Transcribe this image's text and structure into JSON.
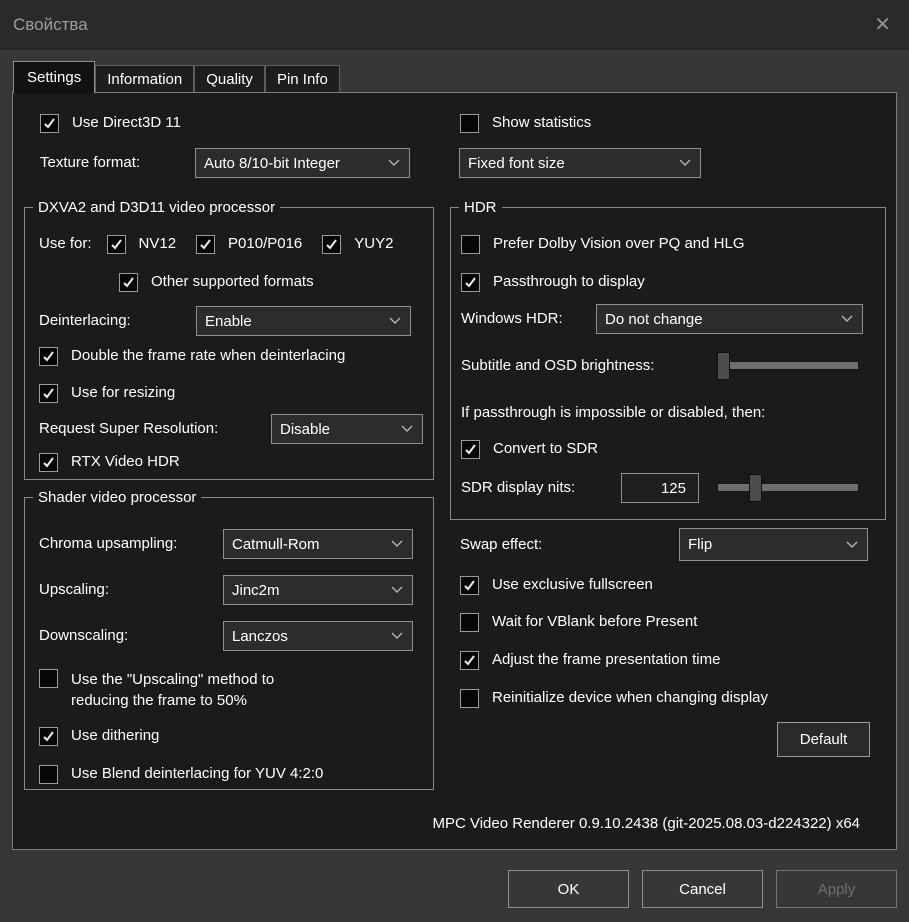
{
  "window": {
    "title": "Свойства"
  },
  "icons": {
    "close": "✕"
  },
  "tabs": {
    "settings": "Settings",
    "information": "Information",
    "quality": "Quality",
    "pin_info": "Pin Info"
  },
  "left": {
    "use_d3d11_label": "Use Direct3D 11",
    "use_d3d11_checked": true,
    "texture_format_label": "Texture format:",
    "texture_format_value": "Auto 8/10-bit Integer",
    "dxva": {
      "title": "DXVA2 and D3D11 video processor",
      "use_for_label": "Use for:",
      "nv12_label": "NV12",
      "nv12_checked": true,
      "p010_label": "P010/P016",
      "p010_checked": true,
      "yuy2_label": "YUY2",
      "yuy2_checked": true,
      "other_label": "Other supported formats",
      "other_checked": true,
      "deinterlacing_label": "Deinterlacing:",
      "deinterlacing_value": "Enable",
      "double_label": "Double the frame rate when deinterlacing",
      "double_checked": true,
      "resizing_label": "Use for resizing",
      "resizing_checked": true,
      "superres_label": "Request Super Resolution:",
      "superres_value": "Disable",
      "rtx_label": "RTX Video HDR",
      "rtx_checked": true
    },
    "shader": {
      "title": "Shader video processor",
      "chroma_label": "Chroma upsampling:",
      "chroma_value": "Catmull-Rom",
      "upscaling_label": "Upscaling:",
      "upscaling_value": "Jinc2m",
      "downscaling_label": "Downscaling:",
      "downscaling_value": "Lanczos",
      "halfres_label": "Use the \"Upscaling\" method to reducing the frame to 50%",
      "halfres_checked": false,
      "dithering_label": "Use dithering",
      "dithering_checked": true,
      "blend_label": "Use Blend deinterlacing for YUV 4:2:0",
      "blend_checked": false
    }
  },
  "right": {
    "show_stats_label": "Show statistics",
    "show_stats_checked": false,
    "font_size_value": "Fixed font size",
    "hdr": {
      "title": "HDR",
      "dolby_label": "Prefer Dolby Vision over PQ and HLG",
      "dolby_checked": false,
      "passthrough_label": "Passthrough to display",
      "passthrough_checked": true,
      "windows_hdr_label": "Windows HDR:",
      "windows_hdr_value": "Do not change",
      "osd_brightness_label": "Subtitle and OSD brightness:",
      "osd_brightness_percent": 0,
      "fallback_text": "If passthrough is impossible or disabled, then:",
      "convert_sdr_label": "Convert to SDR",
      "convert_sdr_checked": true,
      "sdr_nits_label": "SDR display nits:",
      "sdr_nits_value": "125",
      "sdr_nits_percent": 25
    },
    "swap_label": "Swap effect:",
    "swap_value": "Flip",
    "fullscreen_label": "Use exclusive fullscreen",
    "fullscreen_checked": true,
    "vblank_label": "Wait for VBlank before Present",
    "vblank_checked": false,
    "frame_time_label": "Adjust the frame presentation time",
    "frame_time_checked": true,
    "reinit_label": "Reinitialize device when changing display",
    "reinit_checked": false,
    "default_button": "Default"
  },
  "footer": {
    "version": "MPC Video Renderer 0.9.10.2438 (git-2025.08.03-d224322) x64"
  },
  "dialog_buttons": {
    "ok": "OK",
    "cancel": "Cancel",
    "apply": "Apply"
  },
  "colors": {
    "dialog_bg": "#373737",
    "titlebar_bg": "#2a2a2a",
    "panel_bg": "#1b1b1b",
    "border": "#8a8a8a",
    "text": "#ffffff",
    "title_text": "#9d9d9d",
    "disabled_text": "#6f6f6f",
    "slider_track": "#6e6e6e",
    "slider_thumb": "#4d4d4d"
  }
}
